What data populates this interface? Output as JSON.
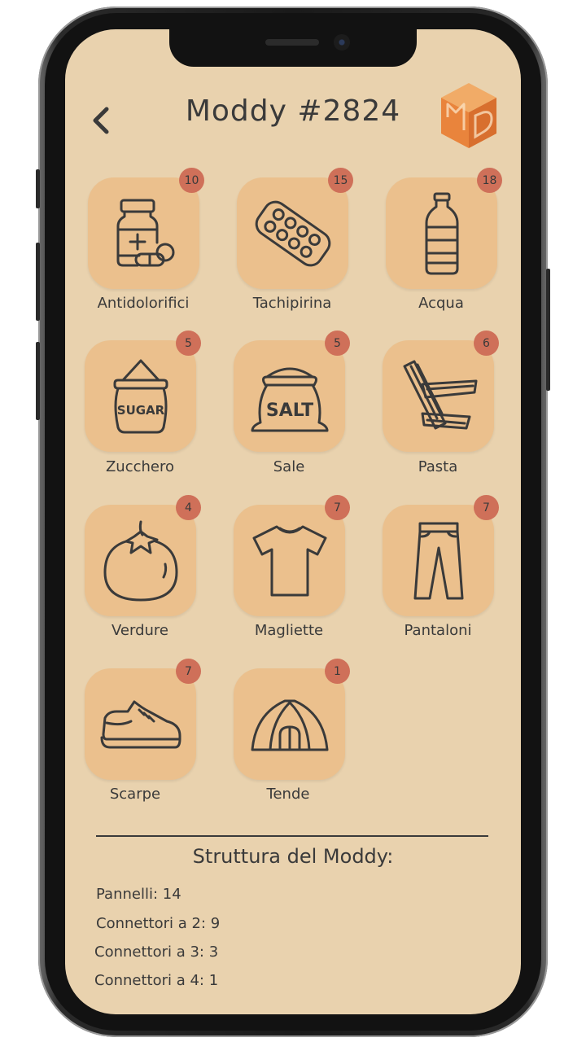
{
  "header": {
    "title": "Moddy #2824",
    "back_icon": "chevron-left-icon",
    "logo_icon": "moddy-cube-logo"
  },
  "colors": {
    "screen_bg": "#e9d2ae",
    "tile_bg": "#ebc08d",
    "badge_bg": "#cf7059",
    "text": "#3a3a3a",
    "logo_orange": "#e9843c"
  },
  "items": [
    {
      "label": "Antidolorifici",
      "count": "10",
      "icon": "medicine-bottle-icon"
    },
    {
      "label": "Tachipirina",
      "count": "15",
      "icon": "pill-blister-icon"
    },
    {
      "label": "Acqua",
      "count": "18",
      "icon": "water-bottle-icon"
    },
    {
      "label": "Zucchero",
      "count": "5",
      "icon": "sugar-sack-icon",
      "icon_text": "SUGAR"
    },
    {
      "label": "Sale",
      "count": "5",
      "icon": "salt-sack-icon",
      "icon_text": "SALT"
    },
    {
      "label": "Pasta",
      "count": "6",
      "icon": "penne-pasta-icon"
    },
    {
      "label": "Verdure",
      "count": "4",
      "icon": "tomato-icon"
    },
    {
      "label": "Magliette",
      "count": "7",
      "icon": "t-shirt-icon"
    },
    {
      "label": "Pantaloni",
      "count": "7",
      "icon": "trousers-icon"
    },
    {
      "label": "Scarpe",
      "count": "7",
      "icon": "sneaker-icon"
    },
    {
      "label": "Tende",
      "count": "1",
      "icon": "tent-icon"
    }
  ],
  "structure": {
    "title": "Struttura del Moddy:",
    "lines": [
      "Pannelli: 14",
      "Connettori a 2: 9",
      "Connettori a 3: 3",
      "Connettori a 4: 1"
    ]
  }
}
